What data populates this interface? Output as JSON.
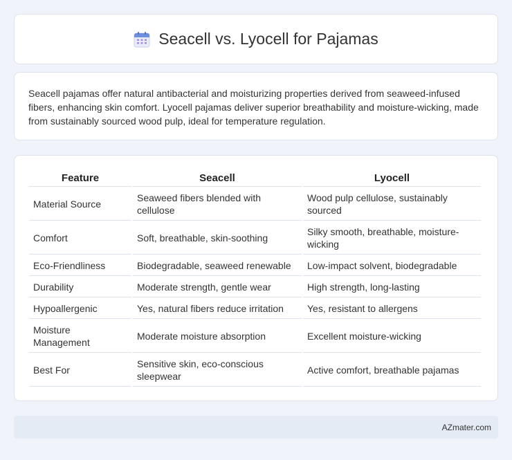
{
  "header": {
    "title": "Seacell vs. Lyocell for Pajamas",
    "icon": "calendar-icon"
  },
  "summary": {
    "text": "Seacell pajamas offer natural antibacterial and moisturizing properties derived from seaweed-infused fibers, enhancing skin comfort. Lyocell pajamas deliver superior breathability and moisture-wicking, made from sustainably sourced wood pulp, ideal for temperature regulation."
  },
  "table": {
    "headers": [
      "Feature",
      "Seacell",
      "Lyocell"
    ],
    "rows": [
      [
        "Material Source",
        "Seaweed fibers blended with cellulose",
        "Wood pulp cellulose, sustainably sourced"
      ],
      [
        "Comfort",
        "Soft, breathable, skin-soothing",
        "Silky smooth, breathable, moisture-wicking"
      ],
      [
        "Eco-Friendliness",
        "Biodegradable, seaweed renewable",
        "Low-impact solvent, biodegradable"
      ],
      [
        "Durability",
        "Moderate strength, gentle wear",
        "High strength, long-lasting"
      ],
      [
        "Hypoallergenic",
        "Yes, natural fibers reduce irritation",
        "Yes, resistant to allergens"
      ],
      [
        "Moisture Management",
        "Moderate moisture absorption",
        "Excellent moisture-wicking"
      ],
      [
        "Best For",
        "Sensitive skin, eco-conscious sleepwear",
        "Active comfort, breathable pajamas"
      ]
    ]
  },
  "footer": {
    "brand": "AZmater.com"
  }
}
